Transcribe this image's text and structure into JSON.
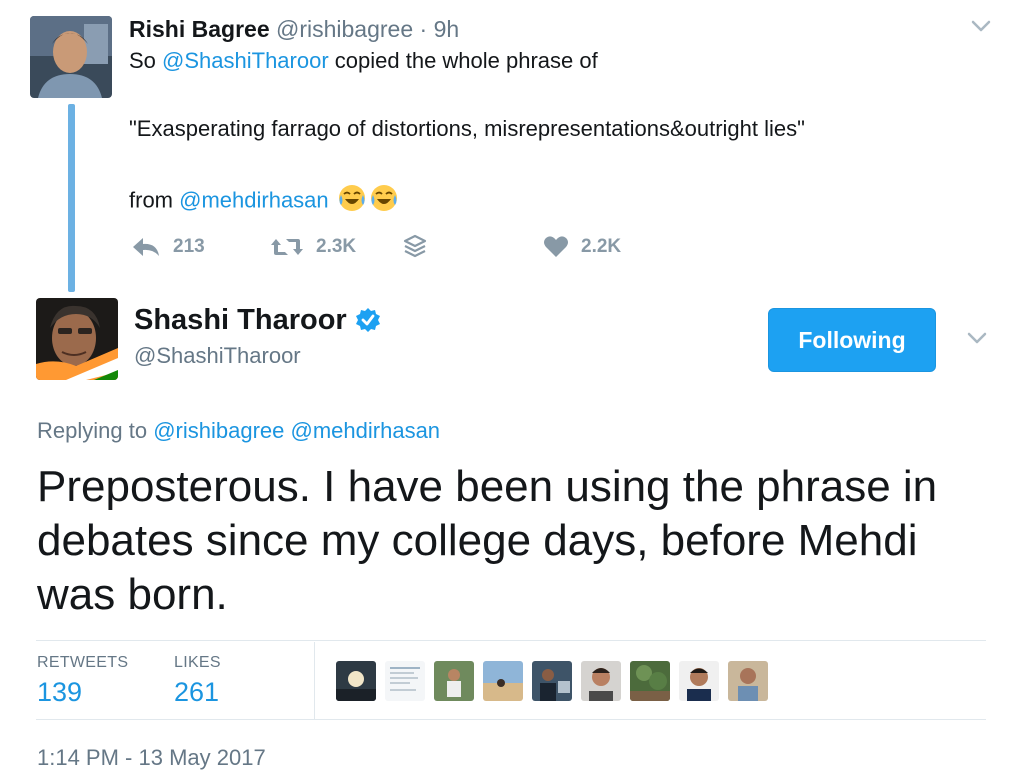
{
  "parent_tweet": {
    "name": "Rishi Bagree",
    "handle": "@rishibagree",
    "dot": "·",
    "time": "9h",
    "line1_prefix": "So ",
    "line1_mention": "@ShashiTharoor",
    "line1_suffix": " copied the whole phrase of",
    "line2": "\"Exasperating farrago of distortions, misrepresentations&outright lies\"",
    "line3_prefix": "from ",
    "line3_mention": "@mehdirhasan",
    "emoji": "tears-of-joy-emoji",
    "reply_count": "213",
    "retweet_count": "2.3K",
    "like_count": "2.2K"
  },
  "main_tweet": {
    "name": "Shashi Tharoor",
    "handle": "@ShashiTharoor",
    "follow_label": "Following",
    "replying_label": "Replying to",
    "reply_mention_1": "@rishibagree",
    "reply_mention_2": "@mehdirhasan",
    "text": "Preposterous. I have been using the phrase in debates since my college days, before Mehdi was born.",
    "retweets_label": "RETWEETS",
    "retweets_value": "139",
    "likes_label": "LIKES",
    "likes_value": "261",
    "timestamp": "1:14 PM - 13 May 2017"
  },
  "colors": {
    "link": "#1b95e0",
    "button": "#1da1f2",
    "muted": "#657786",
    "thread_line": "#6cb1e3"
  },
  "icons": [
    "reply-icon",
    "retweet-icon",
    "stack-icon",
    "heart-icon",
    "verified-icon",
    "chevron-down-icon"
  ]
}
